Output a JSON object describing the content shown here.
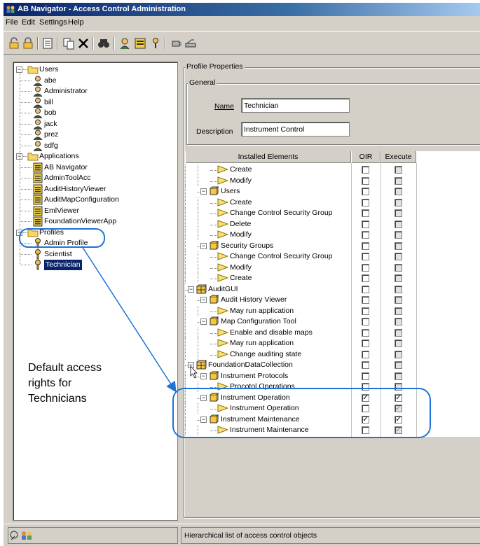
{
  "window": {
    "title": "AB Navigator - Access Control Administration"
  },
  "menu": {
    "file": "File",
    "edit": "Edit",
    "settings": "Settings",
    "help": "Help"
  },
  "tree": {
    "users_label": "Users",
    "users": [
      "abe",
      "Administrator",
      "bill",
      "bob",
      "jack",
      "prez",
      "sdfg"
    ],
    "applications_label": "Applications",
    "applications": [
      "AB Navigator",
      "AdminToolAcc",
      "AuditHistoryViewer",
      "AuditMapConfiguration",
      "EmlViewer",
      "FoundationViewerApp"
    ],
    "profiles_label": "Profiles",
    "profiles": [
      "Admin Profile",
      "Scientist",
      "Technician"
    ]
  },
  "profile": {
    "group_title": "Profile Properties",
    "general_title": "General",
    "name_label": "Name",
    "name_value": "Technician",
    "description_label": "Description",
    "description_value": "Instrument Control"
  },
  "table": {
    "columns": [
      "Installed Elements",
      "OIR",
      "Execute"
    ],
    "rows": [
      {
        "label": "Create",
        "indent": 3,
        "icon": "arrow",
        "oir": false,
        "exec": false,
        "exec_disabled": true
      },
      {
        "label": "Modify",
        "indent": 3,
        "icon": "arrow",
        "oir": false,
        "exec": false,
        "exec_disabled": true
      },
      {
        "label": "Users",
        "indent": 2,
        "icon": "box",
        "oir": false,
        "exec": false,
        "exec_disabled": true
      },
      {
        "label": "Create",
        "indent": 3,
        "icon": "arrow",
        "oir": false,
        "exec": false,
        "exec_disabled": true
      },
      {
        "label": "Change Control Security Group",
        "indent": 3,
        "icon": "arrow",
        "oir": false,
        "exec": false,
        "exec_disabled": true
      },
      {
        "label": "Delete",
        "indent": 3,
        "icon": "arrow",
        "oir": false,
        "exec": false,
        "exec_disabled": true
      },
      {
        "label": "Modify",
        "indent": 3,
        "icon": "arrow",
        "oir": false,
        "exec": false,
        "exec_disabled": true
      },
      {
        "label": "Security Groups",
        "indent": 2,
        "icon": "box",
        "oir": false,
        "exec": false,
        "exec_disabled": true
      },
      {
        "label": "Change Control Security Group",
        "indent": 3,
        "icon": "arrow",
        "oir": false,
        "exec": false,
        "exec_disabled": true
      },
      {
        "label": "Modify",
        "indent": 3,
        "icon": "arrow",
        "oir": false,
        "exec": false,
        "exec_disabled": true
      },
      {
        "label": "Create",
        "indent": 3,
        "icon": "arrow",
        "oir": false,
        "exec": false,
        "exec_disabled": true
      },
      {
        "label": "AuditGUI",
        "indent": 1,
        "icon": "cube",
        "oir": false,
        "exec": false,
        "exec_disabled": true
      },
      {
        "label": "Audit History Viewer",
        "indent": 2,
        "icon": "box",
        "oir": false,
        "exec": false,
        "exec_disabled": true
      },
      {
        "label": "May run application",
        "indent": 3,
        "icon": "arrow",
        "oir": false,
        "exec": false,
        "exec_disabled": true
      },
      {
        "label": "Map Configuration Tool",
        "indent": 2,
        "icon": "box",
        "oir": false,
        "exec": false,
        "exec_disabled": true
      },
      {
        "label": "Enable and disable maps",
        "indent": 3,
        "icon": "arrow",
        "oir": false,
        "exec": false,
        "exec_disabled": true
      },
      {
        "label": "May run application",
        "indent": 3,
        "icon": "arrow",
        "oir": false,
        "exec": false,
        "exec_disabled": true
      },
      {
        "label": "Change auditing state",
        "indent": 3,
        "icon": "arrow",
        "oir": false,
        "exec": false,
        "exec_disabled": true
      },
      {
        "label": "FoundationDataCollection",
        "indent": 1,
        "icon": "cube",
        "oir": false,
        "exec": false,
        "exec_disabled": true
      },
      {
        "label": "Instrument Protocols",
        "indent": 2,
        "icon": "box",
        "oir": false,
        "exec": false,
        "exec_disabled": true
      },
      {
        "label": "Procotol Operations",
        "indent": 3,
        "icon": "arrow",
        "oir": false,
        "exec": false,
        "exec_disabled": true
      },
      {
        "label": "Instrument Operation",
        "indent": 2,
        "icon": "box",
        "oir": true,
        "exec": true,
        "exec_disabled": false
      },
      {
        "label": "Instrument Operation",
        "indent": 3,
        "icon": "arrow",
        "oir": false,
        "exec": true,
        "exec_disabled": true
      },
      {
        "label": "Instrument Maintenance",
        "indent": 2,
        "icon": "box",
        "oir": true,
        "exec": true,
        "exec_disabled": false
      },
      {
        "label": "Instrument Maintenance",
        "indent": 3,
        "icon": "arrow",
        "oir": false,
        "exec": true,
        "exec_disabled": true
      }
    ]
  },
  "annotation": {
    "lines": [
      "Default access",
      "rights for",
      "Technicians"
    ]
  },
  "status": {
    "message": "Hierarchical list of access control objects"
  },
  "colors": {
    "title_bar": "#0a246a",
    "selection": "#0a246a",
    "callout": "#1e73d8",
    "folder": "#f5d76e",
    "arrow_icon": "#f7e07a"
  }
}
